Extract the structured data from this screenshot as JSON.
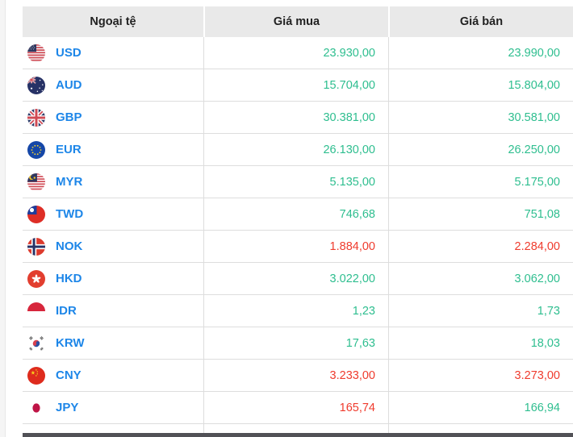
{
  "colors": {
    "up": "#2ebe8f",
    "down": "#ef3b2d",
    "currency_link": "#1d86e8",
    "header_bg": "#e9e9e9",
    "header_text": "#222222",
    "row_border": "#dddddd",
    "dark_bar": "#515156"
  },
  "table": {
    "headers": [
      "Ngoại tệ",
      "Giá mua",
      "Giá bán"
    ],
    "rows": [
      {
        "code": "USD",
        "flag": "usd",
        "buy": "23.930,00",
        "sell": "23.990,00",
        "buy_trend": "up",
        "sell_trend": "up"
      },
      {
        "code": "AUD",
        "flag": "aud",
        "buy": "15.704,00",
        "sell": "15.804,00",
        "buy_trend": "up",
        "sell_trend": "up"
      },
      {
        "code": "GBP",
        "flag": "gbp",
        "buy": "30.381,00",
        "sell": "30.581,00",
        "buy_trend": "up",
        "sell_trend": "up"
      },
      {
        "code": "EUR",
        "flag": "eur",
        "buy": "26.130,00",
        "sell": "26.250,00",
        "buy_trend": "up",
        "sell_trend": "up"
      },
      {
        "code": "MYR",
        "flag": "myr",
        "buy": "5.135,00",
        "sell": "5.175,00",
        "buy_trend": "up",
        "sell_trend": "up"
      },
      {
        "code": "TWD",
        "flag": "twd",
        "buy": "746,68",
        "sell": "751,08",
        "buy_trend": "up",
        "sell_trend": "up"
      },
      {
        "code": "NOK",
        "flag": "nok",
        "buy": "1.884,00",
        "sell": "2.284,00",
        "buy_trend": "down",
        "sell_trend": "down"
      },
      {
        "code": "HKD",
        "flag": "hkd",
        "buy": "3.022,00",
        "sell": "3.062,00",
        "buy_trend": "up",
        "sell_trend": "up"
      },
      {
        "code": "IDR",
        "flag": "idr",
        "buy": "1,23",
        "sell": "1,73",
        "buy_trend": "up",
        "sell_trend": "up"
      },
      {
        "code": "KRW",
        "flag": "krw",
        "buy": "17,63",
        "sell": "18,03",
        "buy_trend": "up",
        "sell_trend": "up"
      },
      {
        "code": "CNY",
        "flag": "cny",
        "buy": "3.233,00",
        "sell": "3.273,00",
        "buy_trend": "down",
        "sell_trend": "down"
      },
      {
        "code": "JPY",
        "flag": "jpy",
        "buy": "165,74",
        "sell": "166,94",
        "buy_trend": "down",
        "sell_trend": "up"
      }
    ]
  }
}
